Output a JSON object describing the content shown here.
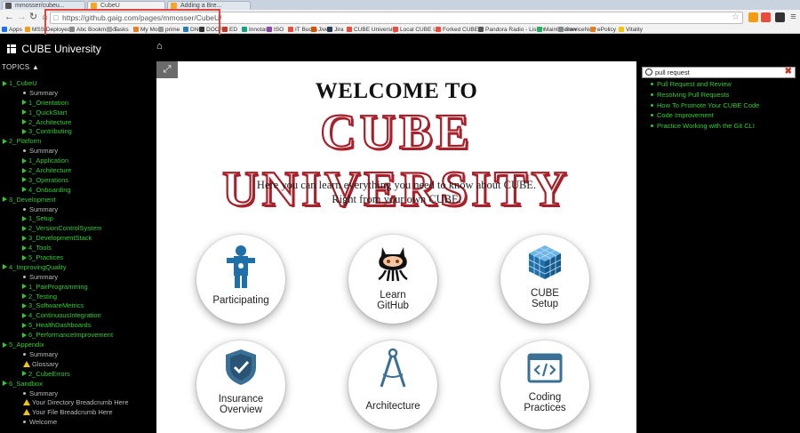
{
  "browser": {
    "tabs": [
      {
        "label": "mmosser/cubeu..."
      },
      {
        "label": "CubeU"
      },
      {
        "label": "Adding a Bre..."
      }
    ],
    "url": "https://github.gaig.com/pages/mmosser/CubeU/",
    "bookmarks": [
      "Apps",
      "MSS Deployed",
      "Abc Bookmarks",
      "Tasks",
      "My Mod",
      "prime",
      "DNG",
      "DOORS",
      "ED",
      "Innotas",
      "ISO",
      "IT Bucks",
      "Jive",
      "Jira",
      "CUBE University",
      "Local CUBE U",
      "Forked CUBE U",
      "Pandora Radio - Listen",
      "Maint Center",
      "ServiceNow",
      "ePolicy",
      "Vitality"
    ]
  },
  "header": {
    "brand": "CUBE University"
  },
  "sidebar": {
    "topics_label": "TOPICS",
    "items": [
      {
        "level": 0,
        "text": "1_CubeU",
        "icon": "triangle"
      },
      {
        "level": 1,
        "text": "Summary",
        "icon": "dot"
      },
      {
        "level": 2,
        "text": "1_Orientation",
        "icon": "triangle"
      },
      {
        "level": 2,
        "text": "1_QuickStart",
        "icon": "triangle"
      },
      {
        "level": 2,
        "text": "2_Architecture",
        "icon": "triangle"
      },
      {
        "level": 2,
        "text": "3_Contributing",
        "icon": "triangle"
      },
      {
        "level": 0,
        "text": "2_Platform",
        "icon": "triangle"
      },
      {
        "level": 1,
        "text": "Summary",
        "icon": "dot"
      },
      {
        "level": 2,
        "text": "1_Application",
        "icon": "triangle"
      },
      {
        "level": 2,
        "text": "2_Architecture",
        "icon": "triangle"
      },
      {
        "level": 2,
        "text": "3_Operations",
        "icon": "triangle"
      },
      {
        "level": 2,
        "text": "4_Onboarding",
        "icon": "triangle"
      },
      {
        "level": 0,
        "text": "3_Development",
        "icon": "triangle"
      },
      {
        "level": 1,
        "text": "Summary",
        "icon": "dot"
      },
      {
        "level": 2,
        "text": "1_Setup",
        "icon": "triangle"
      },
      {
        "level": 2,
        "text": "2_VersionControlSystem",
        "icon": "triangle"
      },
      {
        "level": 2,
        "text": "3_DevelopmentStack",
        "icon": "triangle"
      },
      {
        "level": 2,
        "text": "4_Tools",
        "icon": "triangle"
      },
      {
        "level": 2,
        "text": "5_Practices",
        "icon": "triangle"
      },
      {
        "level": 0,
        "text": "4_ImprovingQuality",
        "icon": "triangle"
      },
      {
        "level": 1,
        "text": "Summary",
        "icon": "dot"
      },
      {
        "level": 2,
        "text": "1_PairProgramming",
        "icon": "triangle"
      },
      {
        "level": 2,
        "text": "2_Testing",
        "icon": "triangle"
      },
      {
        "level": 2,
        "text": "3_SoftwareMetrics",
        "icon": "triangle"
      },
      {
        "level": 2,
        "text": "4_ContinuousIntegration",
        "icon": "triangle"
      },
      {
        "level": 2,
        "text": "5_HealthDashboards",
        "icon": "triangle"
      },
      {
        "level": 2,
        "text": "6_PerformanceImprovement",
        "icon": "triangle"
      },
      {
        "level": 0,
        "text": "5_Appendix",
        "icon": "triangle"
      },
      {
        "level": 1,
        "text": "Summary",
        "icon": "dot"
      },
      {
        "level": 1,
        "text": "Glossary",
        "icon": "warning"
      },
      {
        "level": 2,
        "text": "2_CubeErrors",
        "icon": "triangle"
      },
      {
        "level": 0,
        "text": "6_Sandbox",
        "icon": "triangle"
      },
      {
        "level": 1,
        "text": "Summary",
        "icon": "dot"
      },
      {
        "level": 1,
        "text": "Your Directory Breadcrumb Here",
        "icon": "warning"
      },
      {
        "level": 1,
        "text": "Your File Breadcrumb Here",
        "icon": "warning"
      },
      {
        "level": 1,
        "text": "Welcome",
        "icon": "dot"
      }
    ]
  },
  "main": {
    "welcome": "WELCOME TO",
    "title": "CUBE UNIVERSITY",
    "intro_line1": "Here you can learn everything you need to know about CUBE.",
    "intro_line2": "Right from your own CUBE.",
    "cards": [
      {
        "label1": "Participating",
        "label2": ""
      },
      {
        "label1": "Learn",
        "label2": "GitHub"
      },
      {
        "label1": "CUBE",
        "label2": "Setup"
      },
      {
        "label1": "Insurance",
        "label2": "Overview"
      },
      {
        "label1": "Architecture",
        "label2": ""
      },
      {
        "label1": "Coding",
        "label2": "Practices"
      }
    ]
  },
  "search": {
    "value": "pull request",
    "results": [
      "Pull Request and Review",
      "Resolving Pull Requests",
      "How To Promote Your CUBE Code",
      "Code Improvement",
      "Practice Working with the Git CLI"
    ]
  },
  "colors": {
    "link_green": "#2ecc2e",
    "title_red": "#a8202a",
    "highlight_red": "#e0443e",
    "icon_blue": "#1f6fa8"
  }
}
